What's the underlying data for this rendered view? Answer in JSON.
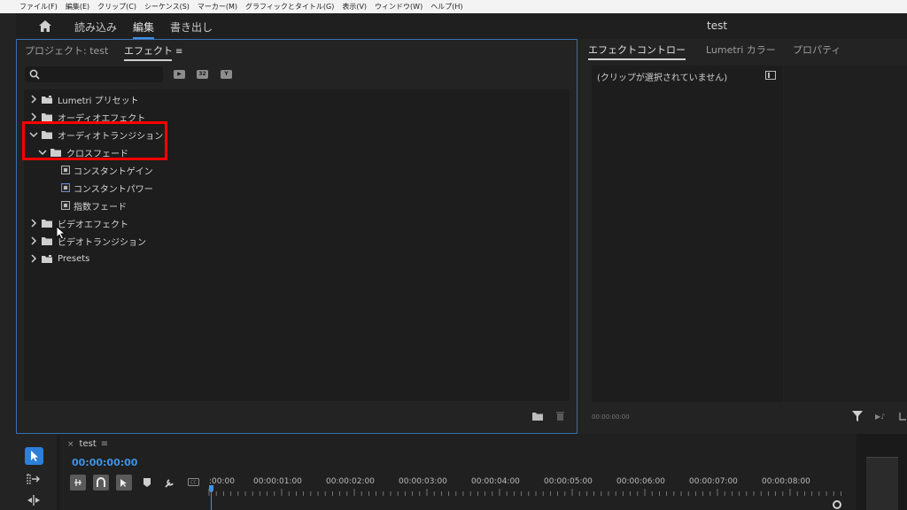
{
  "menubar": {
    "items": [
      "ファイル(F)",
      "編集(E)",
      "クリップ(C)",
      "シーケンス(S)",
      "マーカー(M)",
      "グラフィックとタイトル(G)",
      "表示(V)",
      "ウィンドウ(W)",
      "ヘルプ(H)"
    ]
  },
  "header": {
    "tabs": [
      "読み込み",
      "編集",
      "書き出し"
    ],
    "active_tab": "編集",
    "title": "test"
  },
  "left_panel": {
    "tab_project": "プロジェクト: test",
    "tab_effects": "エフェクト",
    "search": {
      "value": "",
      "placeholder": ""
    },
    "tree": [
      {
        "label": "Lumetri プリセット",
        "type": "folder",
        "expanded": false
      },
      {
        "label": "オーディオエフェクト",
        "type": "folder",
        "expanded": false
      },
      {
        "label": "オーディオトランジション",
        "type": "folder",
        "expanded": true
      },
      {
        "label": "クロスフェード",
        "type": "folder",
        "expanded": true
      },
      {
        "label": "コンスタントゲイン",
        "type": "effect"
      },
      {
        "label": "コンスタントパワー",
        "type": "effect"
      },
      {
        "label": "指数フェード",
        "type": "effect"
      },
      {
        "label": "ビデオエフェクト",
        "type": "folder",
        "expanded": false
      },
      {
        "label": "ビデオトランジション",
        "type": "folder",
        "expanded": false
      },
      {
        "label": "Presets",
        "type": "folder",
        "expanded": false
      }
    ]
  },
  "right_panel": {
    "tabs": [
      "エフェクトコントロー",
      "Lumetri カラー",
      "プロパティ"
    ],
    "no_clip_text": "(クリップが選択されていません)",
    "timecode": "00:00:00:00"
  },
  "timeline": {
    "sequence_name": "test",
    "timecode": "00:00:00:00",
    "ruler_labels": [
      ":00:00",
      "00:00:01:00",
      "00:00:02:00",
      "00:00:03:00",
      "00:00:04:00",
      "00:00:05:00",
      "00:00:06:00",
      "00:00:07:00",
      "00:00:08:00"
    ]
  },
  "colors": {
    "accent": "#3d8fe0",
    "highlight": "#ff0000",
    "panel_border": "#3a6fb0"
  }
}
